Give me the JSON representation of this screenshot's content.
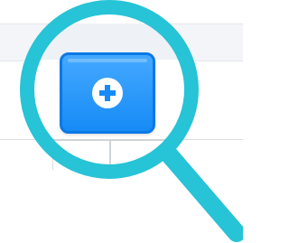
{
  "colors": {
    "lens_ring": "#27c3d6",
    "button_fill": "#168bf6",
    "button_border": "#0a79e6",
    "icon_fill": "#ffffff"
  },
  "icons": {
    "magnifier": "magnifying-glass-icon",
    "add": "plus-circle-icon"
  }
}
